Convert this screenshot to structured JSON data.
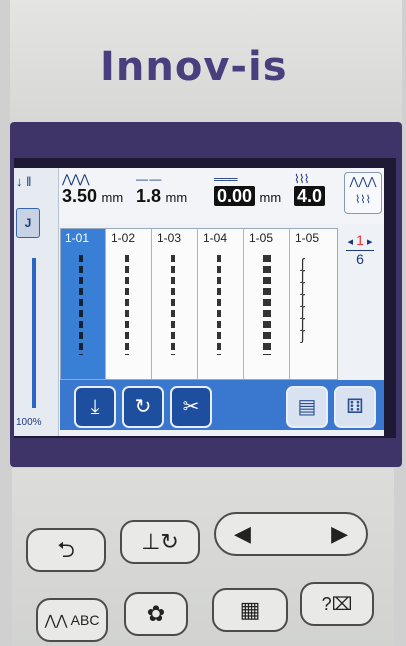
{
  "brand": "Innov-is",
  "screen": {
    "sidebar": {
      "foot_label": "J",
      "speed": "100%"
    },
    "params": {
      "width": {
        "value": "3.50",
        "unit": "mm"
      },
      "length": {
        "value": "1.8",
        "unit": "mm"
      },
      "offset": {
        "value": "0.00",
        "unit": "mm"
      },
      "tension": {
        "value": "4.0"
      }
    },
    "stitches": [
      {
        "code": "1-01",
        "selected": true
      },
      {
        "code": "1-02",
        "selected": false
      },
      {
        "code": "1-03",
        "selected": false
      },
      {
        "code": "1-04",
        "selected": false
      },
      {
        "code": "1-05",
        "selected": false
      },
      {
        "code": "1-05",
        "selected": false
      }
    ],
    "pager": {
      "current": "1",
      "total": "6"
    }
  },
  "icons": {
    "needle": "needle-icon",
    "presser_foot": "presser-foot-icon",
    "width": "stitch-width-icon",
    "length": "stitch-length-icon",
    "offset": "needle-position-icon",
    "tension": "thread-tension-icon",
    "reverse": "reverse-stitch-icon",
    "reinforce": "reinforcement-icon",
    "scissors": "scissors-icon",
    "memory": "memory-icon",
    "stitch_mode": "stitch-mode-icon",
    "back": "back-arrow-icon",
    "foot_up": "presser-foot-rotate-icon",
    "prev": "left-arrow-icon",
    "next": "right-arrow-icon",
    "alphabet": "character-stitch-icon",
    "embroidery": "embroidery-icon",
    "settings": "settings-page-icon",
    "help": "help-icon"
  },
  "colors": {
    "accent": "#3a78d0",
    "brand": "#4a3f7e"
  }
}
